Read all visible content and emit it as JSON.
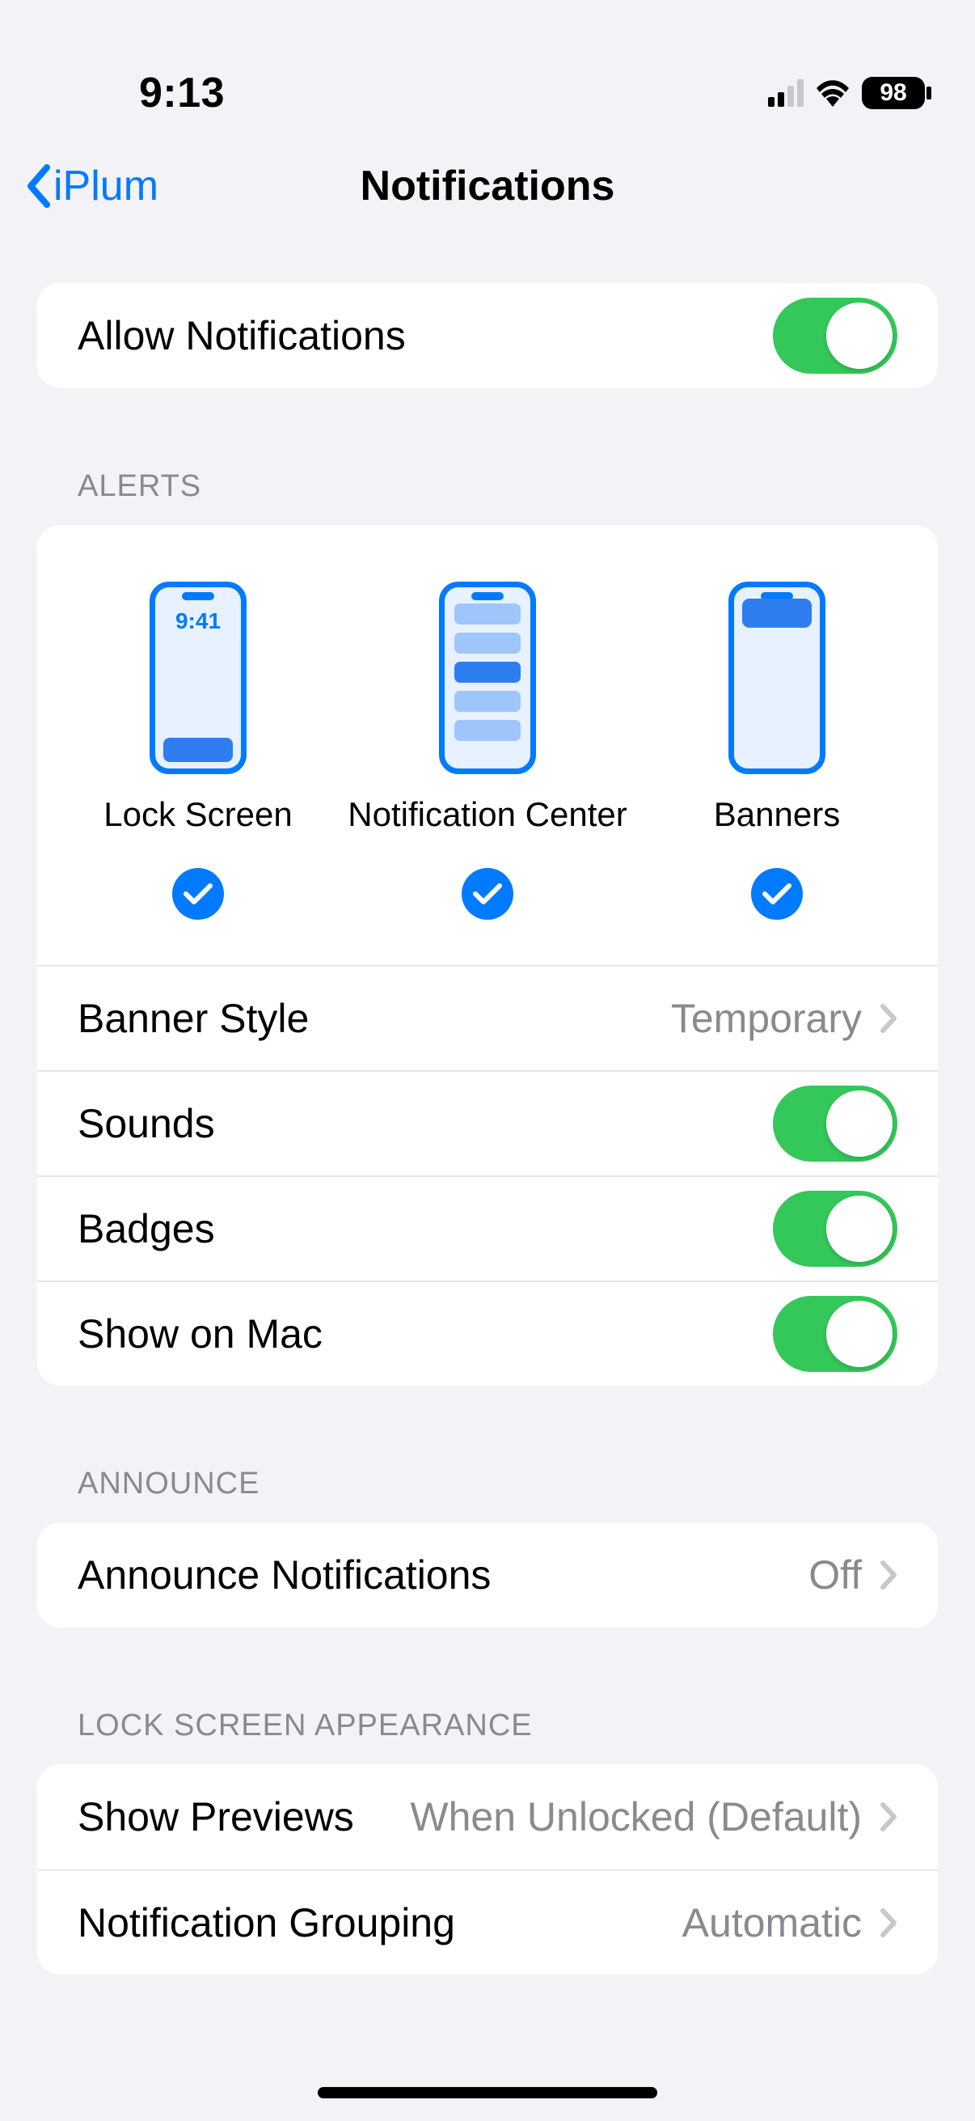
{
  "status": {
    "time": "9:13",
    "battery": "98"
  },
  "nav": {
    "back": "iPlum",
    "title": "Notifications"
  },
  "allow": {
    "label": "Allow Notifications",
    "on": true
  },
  "alerts": {
    "header": "ALERTS",
    "options": [
      {
        "label": "Lock Screen",
        "checked": true,
        "phone_time": "9:41"
      },
      {
        "label": "Notification Center",
        "checked": true
      },
      {
        "label": "Banners",
        "checked": true
      }
    ],
    "banner_style": {
      "label": "Banner Style",
      "value": "Temporary"
    },
    "sounds": {
      "label": "Sounds",
      "on": true
    },
    "badges": {
      "label": "Badges",
      "on": true
    },
    "show_on_mac": {
      "label": "Show on Mac",
      "on": true
    }
  },
  "announce": {
    "header": "ANNOUNCE",
    "row": {
      "label": "Announce Notifications",
      "value": "Off"
    }
  },
  "lock_screen_appearance": {
    "header": "LOCK SCREEN APPEARANCE",
    "show_previews": {
      "label": "Show Previews",
      "value": "When Unlocked (Default)"
    },
    "grouping": {
      "label": "Notification Grouping",
      "value": "Automatic"
    }
  }
}
